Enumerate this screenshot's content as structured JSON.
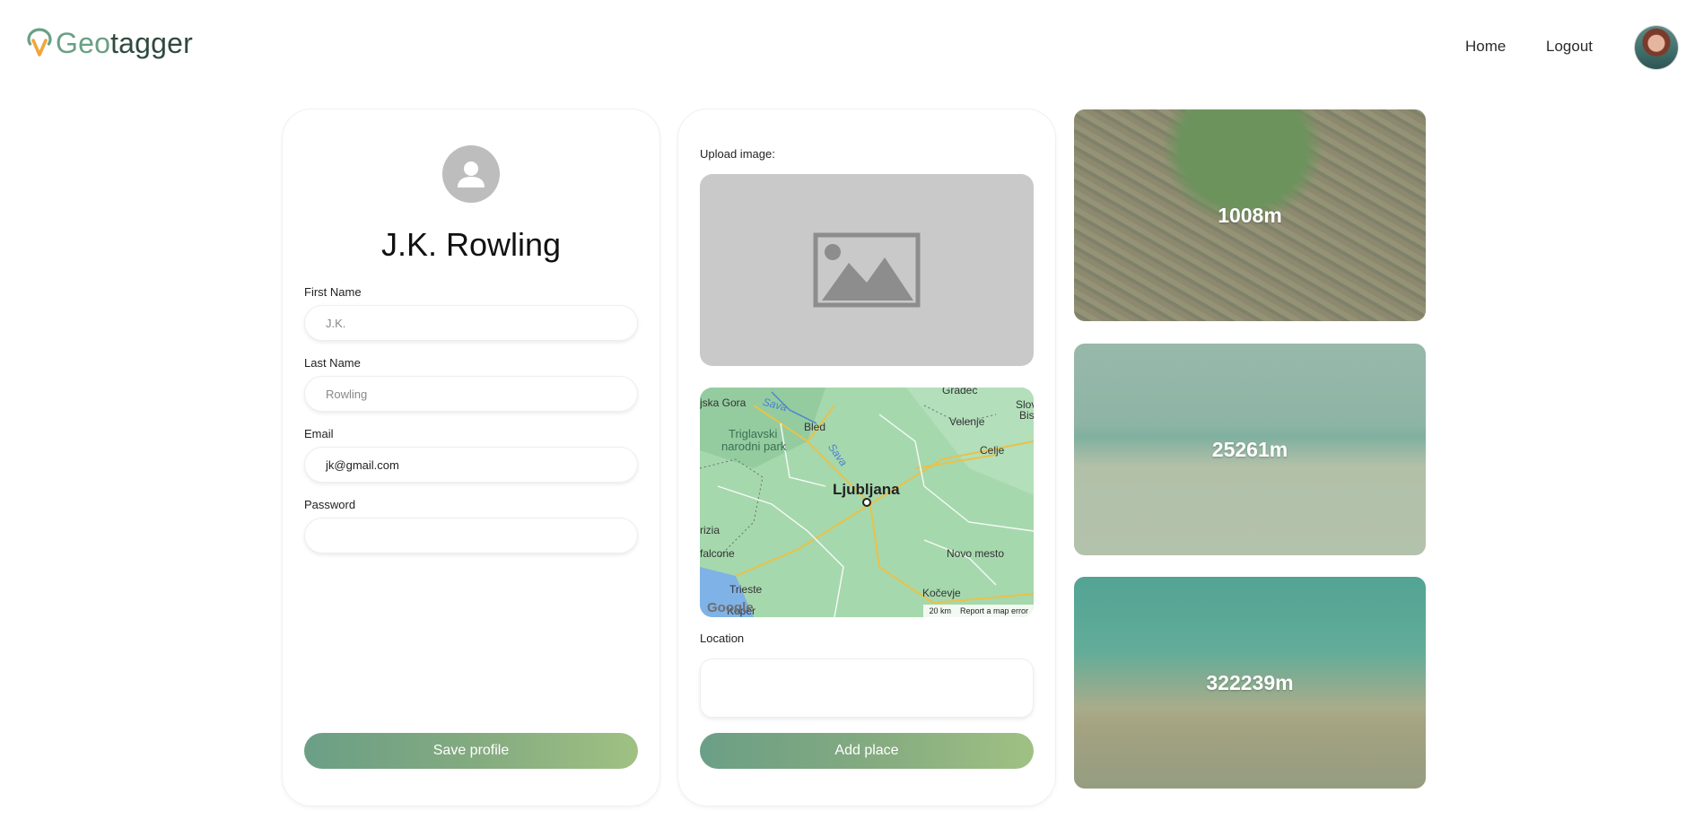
{
  "header": {
    "logo": {
      "part1": "Geo",
      "part2": "tagger"
    },
    "nav": {
      "home": "Home",
      "logout": "Logout"
    }
  },
  "profile": {
    "name": "J.K. Rowling",
    "fields": {
      "first_name": {
        "label": "First Name",
        "placeholder": "J.K.",
        "value": ""
      },
      "last_name": {
        "label": "Last Name",
        "placeholder": "Rowling",
        "value": ""
      },
      "email": {
        "label": "Email",
        "value": "jk@gmail.com"
      },
      "password": {
        "label": "Password",
        "value": ""
      }
    },
    "save_button": "Save profile"
  },
  "place": {
    "upload_label": "Upload image:",
    "map": {
      "labels": {
        "ljubljana": "Ljubljana",
        "bled": "Bled",
        "triglavski": "Triglavski",
        "narodni": "narodni park",
        "celje": "Celje",
        "velenje": "Velenje",
        "novo_mesto": "Novo mesto",
        "kocevje": "Kočevje",
        "trieste": "Trieste",
        "koper": "Koper",
        "falcone": "falcone",
        "gorizia": "rizia",
        "gradec": "Gradec",
        "slov": "Slov",
        "bis": "Bis",
        "kranjska": "jska Gora",
        "sava1": "Sava",
        "sava2": "Sava",
        "google": "Google",
        "scale": "20 km",
        "report": "Report a map error"
      }
    },
    "location_label": "Location",
    "location_value": "",
    "add_button": "Add place"
  },
  "guesses": [
    {
      "distance": "1008m"
    },
    {
      "distance": "25261m"
    },
    {
      "distance": "322239m"
    }
  ],
  "colors": {
    "accent_start": "#6b9f86",
    "accent_end": "#a0c183",
    "logo_green": "#6aa084",
    "logo_orange": "#f0a63a"
  }
}
